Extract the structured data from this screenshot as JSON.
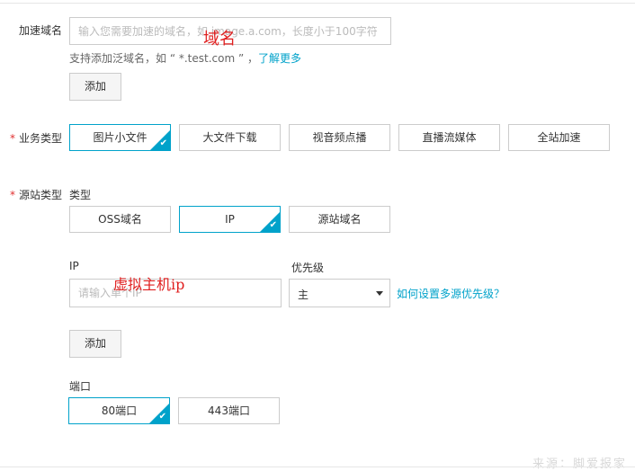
{
  "domain_section": {
    "label": "加速域名",
    "input_placeholder": "输入您需要加速的域名，如 image.a.com，长度小于100字符",
    "hint_text": "支持添加泛域名，如 “ *.test.com ” ，",
    "hint_link": "了解更多",
    "add_button": "添加",
    "annotation": "域名"
  },
  "business_type": {
    "required_mark": "*",
    "label": "业务类型",
    "options": [
      "图片小文件",
      "大文件下载",
      "视音频点播",
      "直播流媒体",
      "全站加速"
    ],
    "selected_index": 0
  },
  "origin_type": {
    "required_mark": "*",
    "label": "源站类型",
    "type_label": "类型",
    "options": [
      "OSS域名",
      "IP",
      "源站域名"
    ],
    "selected_index": 1
  },
  "ip_section": {
    "ip_label": "IP",
    "ip_placeholder": "请输入单个IP",
    "annotation": "虚拟主机ip",
    "priority_label": "优先级",
    "priority_value": "主",
    "priority_help_link": "如何设置多源优先级？",
    "add_button": "添加"
  },
  "port_section": {
    "label": "端口",
    "options": [
      "80端口",
      "443端口"
    ],
    "selected_index": 0
  },
  "watermark": "来源：脚爱报家",
  "colors": {
    "accent": "#00a2ca",
    "required": "#e03030",
    "annotation": "#e01f1f"
  }
}
